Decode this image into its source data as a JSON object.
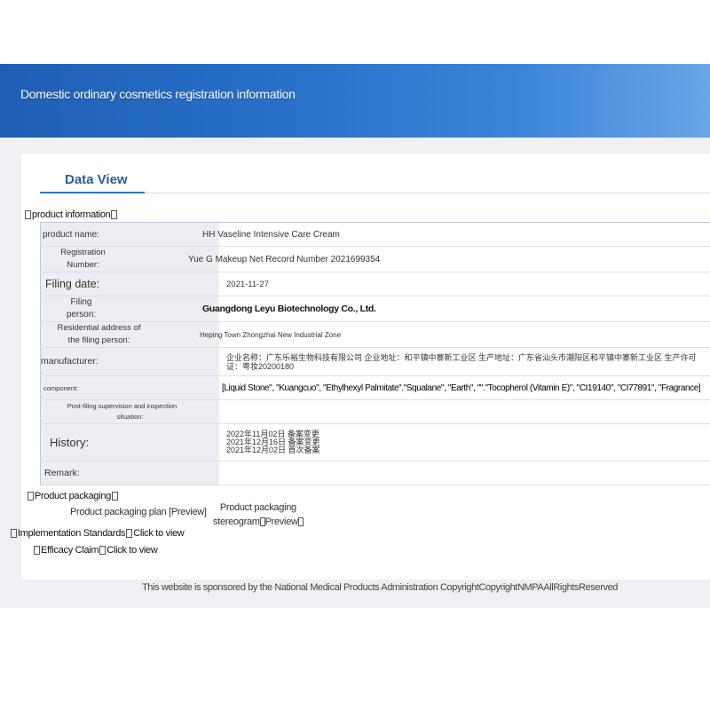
{
  "banner": {
    "title": "Domestic ordinary cosmetics registration information"
  },
  "tab": {
    "label": "Data View"
  },
  "sections": {
    "product_info": "product information",
    "packaging": "Product packaging",
    "standards": "Implementation Standards",
    "standards_link": "Click to view",
    "efficacy": "Efficacy Claim",
    "efficacy_link": "Click to view"
  },
  "fields": {
    "product_name": {
      "label": "product name:",
      "value": "HH Vaseline Intensive Care Cream"
    },
    "registration_number": {
      "label_1": "Registration",
      "label_2": "Number:",
      "value": "Yue G Makeup Net Record Number 2021699354"
    },
    "filing_date": {
      "label": "Filing date:",
      "value": "2021-11-27"
    },
    "filing_person": {
      "label_1": "Filing",
      "label_2": "person:",
      "value": "Guangdong Leyu Biotechnology Co., Ltd."
    },
    "residential_address": {
      "label_1": "Residential address of",
      "label_2": "the filing person:",
      "value": "Heping Town Zhongzhai New Industrial Zone"
    },
    "manufacturer": {
      "label": "manufacturer:",
      "value": "企业名称：广东乐裕生物科技有限公司 企业地址：和平镇中寨新工业区 生产地址：广东省汕头市潮阳区和平镇中寨新工业区 生产许可证：粤妆20200180"
    },
    "component": {
      "label": "component:",
      "value": "[Liquid Stone\", \"Kuangcuo\", \"Ethylhexyl Palmitate\".\"Squalane\", \"Earth\", \"\".\"Tocopherol (Vitamin E)\", \"CI19140\", \"CI77891\", \"Fragrance]"
    },
    "supervision": {
      "label_1": "Post-filing supervision and inspection",
      "label_2": "situation:",
      "value": ""
    },
    "history": {
      "label": "History:",
      "entries": [
        "2022年11月02日 备案变更",
        "2021年12月16日 备案变更",
        "2021年12月02日 首次备案"
      ]
    },
    "remark": {
      "label": "Remark:",
      "value": ""
    }
  },
  "packaging": {
    "plan_label": "Product packaging plan [Preview]",
    "stereogram_label_1": "Product packaging",
    "stereogram_label_2": "stereogram",
    "stereogram_preview": "Preview"
  },
  "footer": {
    "text": "This website is sponsored by the National Medical Products Administration CopyrightCopyrightNMPAAllRightsReserved"
  },
  "colors": {
    "banner": "#2a72cc",
    "tab_accent": "#2f78c9",
    "label_bg": "#eceef2"
  }
}
